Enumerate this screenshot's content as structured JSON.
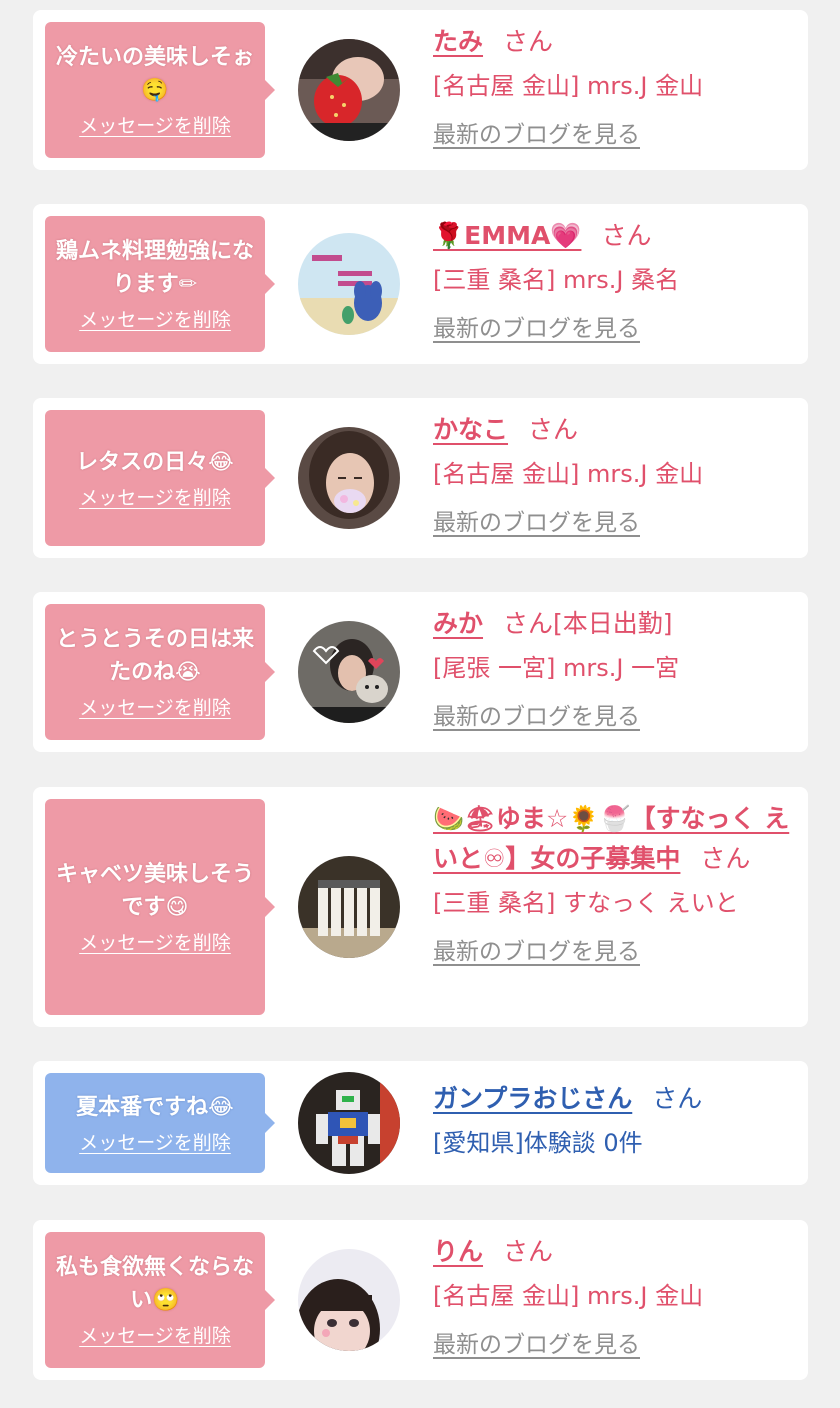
{
  "items": [
    {
      "message": "冷たいの美味しそぉ🤤",
      "delete_label": "メッセージを削除",
      "name": "たみ",
      "honorific": "さん",
      "status": "",
      "shop": "[名古屋 金山] mrs.J 金山",
      "blog_link": "最新のブログを見る",
      "bubble_color": "#ee9aa6",
      "avatar": "strawberry-photo"
    },
    {
      "message": "鶏ムネ料理勉強になります✏",
      "delete_label": "メッセージを削除",
      "name": "🌹EMMA💗",
      "honorific": "さん",
      "status": "",
      "shop": "[三重 桑名] mrs.J 桑名",
      "blog_link": "最新のブログを見る",
      "bubble_color": "#ee9aa6",
      "avatar": "stitch-photo"
    },
    {
      "message": "レタスの日々😂",
      "delete_label": "メッセージを削除",
      "name": "かなこ",
      "honorific": "さん",
      "status": "",
      "shop": "[名古屋 金山] mrs.J 金山",
      "blog_link": "最新のブログを見る",
      "bubble_color": "#ee9aa6",
      "avatar": "portrait-photo"
    },
    {
      "message": "とうとうその日は来たのね😭",
      "delete_label": "メッセージを削除",
      "name": "みか",
      "honorific": "さん",
      "status": "[本日出勤]",
      "shop": "[尾張 一宮] mrs.J 一宮",
      "blog_link": "最新のブログを見る",
      "bubble_color": "#ee9aa6",
      "avatar": "cat-photo"
    },
    {
      "message": "キャベツ美味しそうです😋",
      "delete_label": "メッセージを削除",
      "name": "🍉🏖ゆま☆🌻🍧【すなっく えいと♾】女の子募集中",
      "honorific": "さん",
      "status": "",
      "shop": "[三重 桑名] すなっく えいと",
      "blog_link": "最新のブログを見る",
      "bubble_color": "#ee9aa6",
      "avatar": "bottles-photo"
    },
    {
      "message": "夏本番ですね😂",
      "delete_label": "メッセージを削除",
      "name": "ガンプラおじさん",
      "honorific": "さん",
      "status": "",
      "shop": "[愛知県]体験談 0件",
      "blog_link": "",
      "bubble_color": "#8fb3ec",
      "avatar": "gundam-photo"
    },
    {
      "message": "私も食欲無くならない🙄",
      "delete_label": "メッセージを削除",
      "name": "りん",
      "honorific": "さん",
      "status": "",
      "shop": "[名古屋 金山] mrs.J 金山",
      "blog_link": "最新のブログを見る",
      "bubble_color": "#ee9aa6",
      "avatar": "girl-photo"
    }
  ]
}
